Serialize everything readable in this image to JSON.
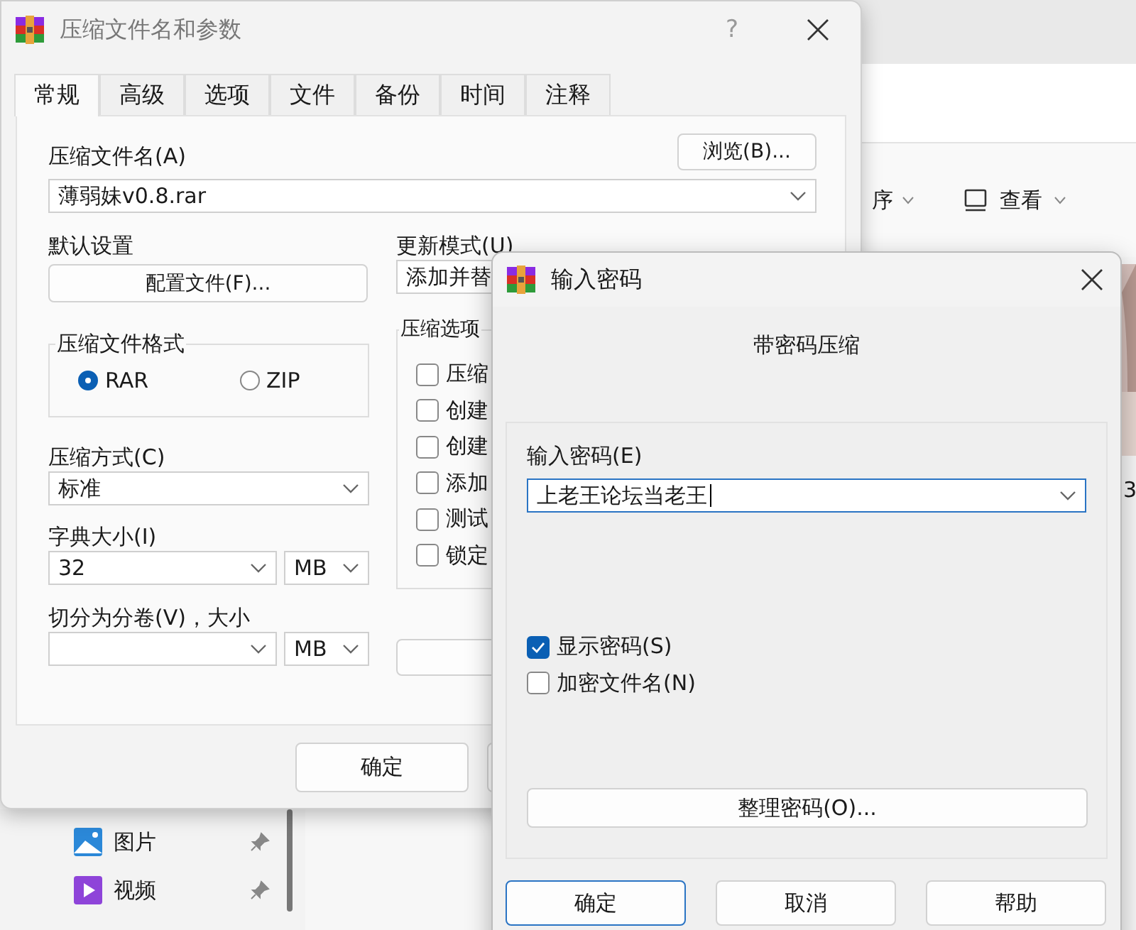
{
  "explorer": {
    "toolbar_items": [
      {
        "label": "序"
      },
      {
        "label": "查看"
      }
    ],
    "nav_items": [
      {
        "label": "图片",
        "kind": "pictures"
      },
      {
        "label": "视频",
        "kind": "videos"
      }
    ],
    "column_text": "3"
  },
  "main_dialog": {
    "title": "压缩文件名和参数",
    "help_button": "?",
    "tabs": [
      {
        "label": "常规",
        "selected": true
      },
      {
        "label": "高级",
        "selected": false
      },
      {
        "label": "选项",
        "selected": false
      },
      {
        "label": "文件",
        "selected": false
      },
      {
        "label": "备份",
        "selected": false
      },
      {
        "label": "时间",
        "selected": false
      },
      {
        "label": "注释",
        "selected": false
      }
    ],
    "archive_name_label": "压缩文件名(A)",
    "browse_button": "浏览(B)...",
    "archive_name_value": "薄弱妹v0.8.rar",
    "default_settings_label": "默认设置",
    "profiles_button": "配置文件(F)...",
    "update_mode_label": "更新模式(U)",
    "update_mode_value": "添加并替",
    "format_group": {
      "legend": "压缩文件格式",
      "options": [
        {
          "label": "RAR",
          "selected": true
        },
        {
          "label": "ZIP",
          "selected": false
        }
      ]
    },
    "method_label": "压缩方式(C)",
    "method_value": "标准",
    "dictionary_label": "字典大小(I)",
    "dictionary_value": "32",
    "dictionary_unit": "MB",
    "split_label": "切分为分卷(V)，大小",
    "split_unit": "MB",
    "options_group": {
      "legend": "压缩选项",
      "options": [
        {
          "label": "压缩",
          "checked": false
        },
        {
          "label": "创建",
          "checked": false
        },
        {
          "label": "创建",
          "checked": false
        },
        {
          "label": "添加",
          "checked": false
        },
        {
          "label": "测试",
          "checked": false
        },
        {
          "label": "锁定",
          "checked": false
        }
      ]
    },
    "buttons": [
      "确定"
    ]
  },
  "password_dialog": {
    "title": "输入密码",
    "heading": "带密码压缩",
    "password_label": "输入密码(E)",
    "password_value": "上老王论坛当老王",
    "options": [
      {
        "label": "显示密码(S)",
        "checked": true
      },
      {
        "label": "加密文件名(N)",
        "checked": false
      }
    ],
    "organize_button": "整理密码(O)...",
    "buttons": [
      {
        "label": "确定",
        "selected": true
      },
      {
        "label": "取消",
        "selected": false
      },
      {
        "label": "帮助",
        "selected": false
      }
    ]
  }
}
